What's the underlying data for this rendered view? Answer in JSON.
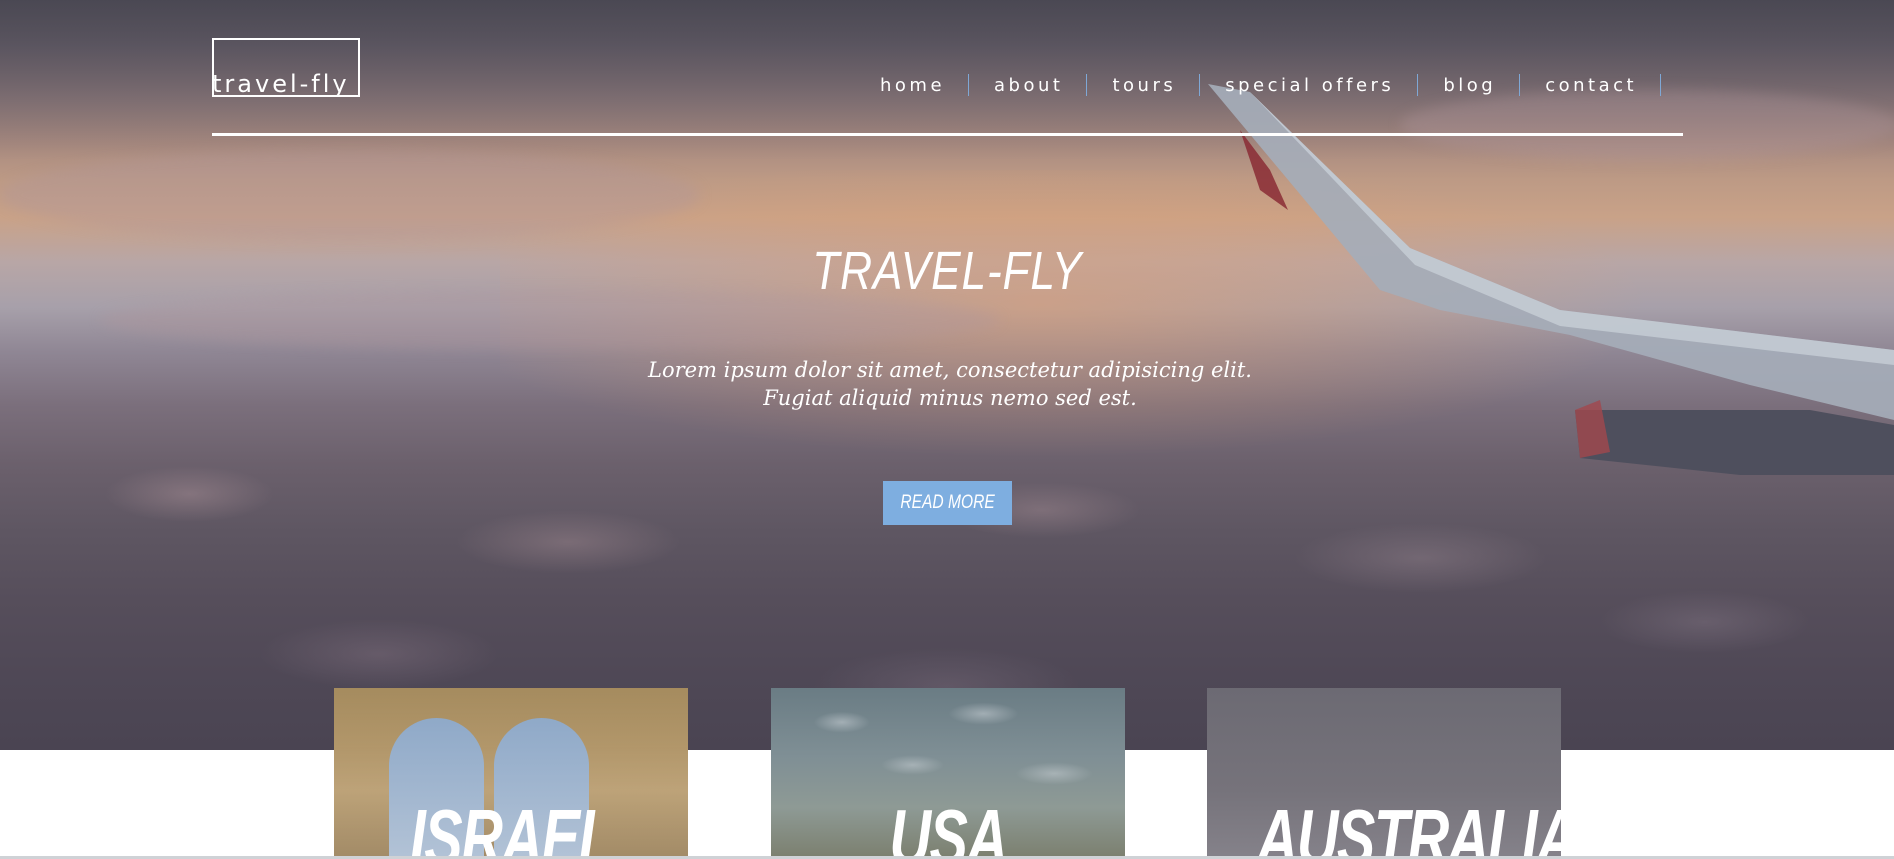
{
  "header": {
    "logo_text": "travel-fly",
    "nav": [
      {
        "label": "home"
      },
      {
        "label": "about"
      },
      {
        "label": "tours"
      },
      {
        "label": "special offers"
      },
      {
        "label": "blog"
      },
      {
        "label": "contact"
      }
    ]
  },
  "hero": {
    "title": "TRAVEL-FLY",
    "subtitle": "Lorem ipsum dolor sit amet, consectetur adipisicing elit. Fugiat aliquid minus nemo sed est.",
    "button_label": "READ MORE"
  },
  "destinations": [
    {
      "name": "ISRAEL"
    },
    {
      "name": "USA"
    },
    {
      "name": "AUSTRALIA"
    }
  ],
  "colors": {
    "accent": "#7eaee0",
    "nav_separator": "#7fa8d6",
    "text_on_hero": "#ffffff"
  }
}
